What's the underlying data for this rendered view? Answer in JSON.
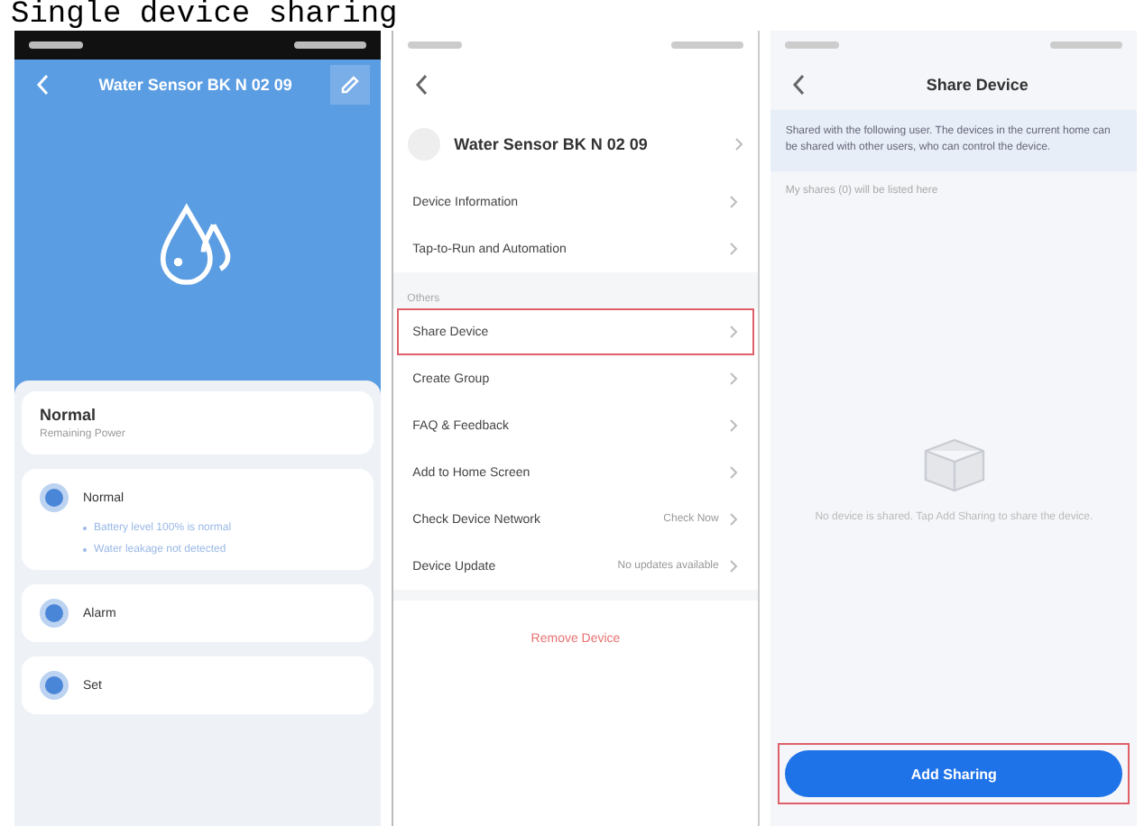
{
  "heading": "Single device sharing",
  "device_screen": {
    "title": "Water Sensor BK N 02 09",
    "status": "Normal",
    "status_note": "Remaining Power",
    "sections": [
      {
        "label": "Normal",
        "lines": [
          "Battery level 100% is normal",
          "Water leakage not detected"
        ]
      },
      {
        "label": "Alarm"
      },
      {
        "label": "Set"
      }
    ]
  },
  "settings_screen": {
    "title": "Water Sensor BK N 02 09",
    "items": [
      {
        "label": "Device Information",
        "highlighted": false
      },
      {
        "label": "Tap-to-Run and Automation",
        "highlighted": false
      },
      {
        "kind": "section",
        "label": "Others"
      },
      {
        "label": "Share Device",
        "highlighted": true
      },
      {
        "label": "Create Group",
        "highlighted": false
      },
      {
        "label": "FAQ & Feedback",
        "highlighted": false
      },
      {
        "label": "Add to Home Screen",
        "highlighted": false
      },
      {
        "label": "Check Device Network",
        "value": "Check Now",
        "highlighted": false
      },
      {
        "label": "Device Update",
        "value": "No updates available",
        "highlighted": false
      }
    ],
    "remove_label": "Remove Device"
  },
  "share_screen": {
    "title": "Share Device",
    "description": "Shared with the following user. The devices in the current home can be shared with other users, who can control the device.",
    "list_label": "My shares (0) will be listed here",
    "empty_text": "No device is shared. Tap Add Sharing to share the device.",
    "button": {
      "label": "Add Sharing",
      "highlighted": true
    }
  }
}
